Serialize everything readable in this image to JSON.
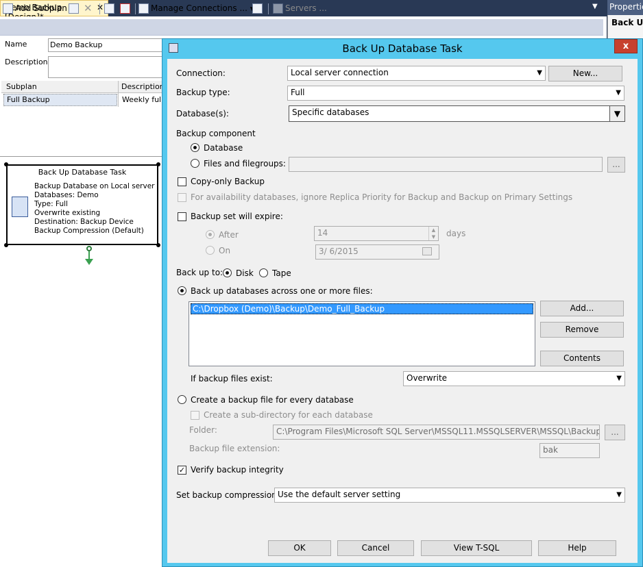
{
  "ide": {
    "doc_tab": "Demo Backup [Design]*",
    "toolbar": {
      "add_subplan": "Add Subplan",
      "manage_connections": "Manage Connections ...",
      "servers": "Servers ..."
    },
    "name_label": "Name",
    "name_value": "Demo Backup",
    "description_label": "Description",
    "grid": {
      "col_subplan": "Subplan",
      "col_description": "Description",
      "row_subplan": "Full Backup",
      "row_description": "Weekly full b"
    },
    "task": {
      "title": "Back Up Database Task",
      "lines": [
        "Backup Database on Local server",
        "Databases: Demo",
        "Type: Full",
        "Overwrite existing",
        "Destination: Backup Device",
        "Backup Compression (Default)"
      ]
    },
    "properties": {
      "title": "Properties",
      "subtitle": "Back Up"
    }
  },
  "dialog": {
    "title": "Back Up Database Task",
    "close": "x",
    "connection_label": "Connection:",
    "connection_value": "Local server connection",
    "new_button": "New...",
    "backup_type_label": "Backup type:",
    "backup_type_value": "Full",
    "databases_label": "Database(s):",
    "databases_value": "Specific databases",
    "backup_component_label": "Backup component",
    "component_database": "Database",
    "component_files": "Files and filegroups:",
    "ellipsis": "...",
    "copy_only": "Copy-only Backup",
    "availability": "For availability databases, ignore Replica Priority for Backup and Backup on Primary Settings",
    "expire": "Backup set will expire:",
    "after_label": "After",
    "after_value": "14",
    "days_label": "days",
    "on_label": "On",
    "on_value": "3/  6/2015",
    "back_up_to_label": "Back up to:",
    "disk_label": "Disk",
    "tape_label": "Tape",
    "across_files": "Back up databases across one or more files:",
    "file_path": "C:\\Dropbox (Demo)\\Backup\\Demo_Full_Backup",
    "add_button": "Add...",
    "remove_button": "Remove",
    "contents_button": "Contents",
    "if_exist_label": "If backup files exist:",
    "if_exist_value": "Overwrite",
    "create_per_db": "Create a backup file for every database",
    "create_subdir": "Create a sub-directory for each database",
    "folder_label": "Folder:",
    "folder_value": "C:\\Program Files\\Microsoft SQL Server\\MSSQL11.MSSQLSERVER\\MSSQL\\Backup",
    "ext_label": "Backup file extension:",
    "ext_value": "bak",
    "verify": "Verify backup integrity",
    "compression_label": "Set backup compression:",
    "compression_value": "Use the default server setting",
    "ok_button": "OK",
    "cancel_button": "Cancel",
    "tsql_button": "View T-SQL",
    "help_button": "Help"
  },
  "colors": {
    "dialog_frame": "#55c8ee",
    "close_button": "#c7402e",
    "selection": "#3399ff",
    "ide_frame": "#293955"
  }
}
